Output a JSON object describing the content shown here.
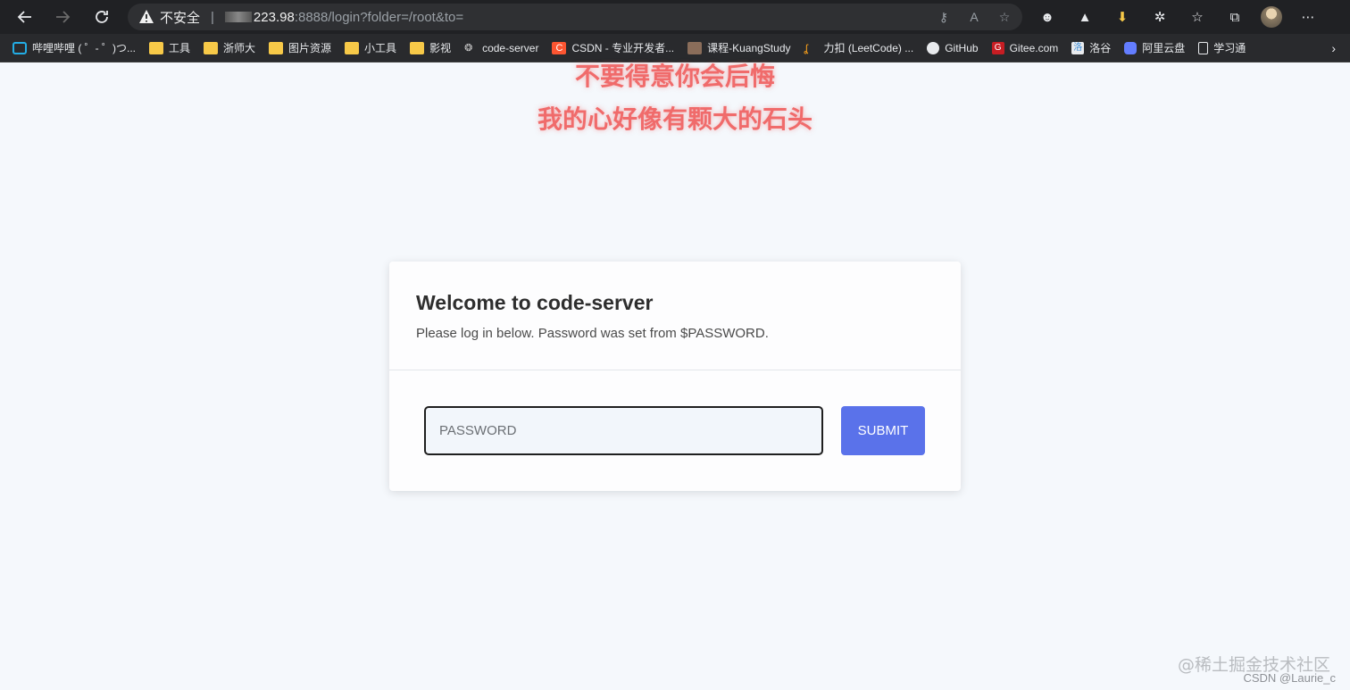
{
  "browser": {
    "insecure_label": "不安全",
    "url_host": "223.98",
    "url_rest": ":8888/login?folder=/root&to="
  },
  "bookmarks": [
    {
      "label": "哔哩哔哩 ( ゜- ゜)つ...",
      "icon": "bilibili-icon",
      "color": "#23ade5"
    },
    {
      "label": "工具",
      "icon": "folder-icon"
    },
    {
      "label": "浙师大",
      "icon": "folder-icon"
    },
    {
      "label": "图片资源",
      "icon": "folder-icon"
    },
    {
      "label": "小工具",
      "icon": "folder-icon"
    },
    {
      "label": "影视",
      "icon": "folder-icon"
    },
    {
      "label": "code-server",
      "icon": "code-server-icon"
    },
    {
      "label": "CSDN - 专业开发者...",
      "icon": "csdn-icon",
      "color": "#fc5531"
    },
    {
      "label": "课程-KuangStudy",
      "icon": "kuangstudy-icon"
    },
    {
      "label": "力扣 (LeetCode) ...",
      "icon": "leetcode-icon"
    },
    {
      "label": "GitHub",
      "icon": "github-icon"
    },
    {
      "label": "Gitee.com",
      "icon": "gitee-icon",
      "color": "#c71d23"
    },
    {
      "label": "洛谷",
      "icon": "luogu-icon"
    },
    {
      "label": "阿里云盘",
      "icon": "aliyun-drive-icon",
      "color": "#637dff"
    },
    {
      "label": "学习通",
      "icon": "document-icon"
    }
  ],
  "overlay": {
    "line1": "不要得意你会后悔",
    "line2": "我的心好像有颗大的石头"
  },
  "login": {
    "title": "Welcome to code-server",
    "subtitle": "Please log in below. Password was set from $PASSWORD.",
    "password_placeholder": "PASSWORD",
    "submit_label": "SUBMIT",
    "accent": "#5a72ea"
  },
  "watermark": {
    "line1": "@稀土掘金技术社区",
    "line2": "CSDN @Laurie_c"
  }
}
